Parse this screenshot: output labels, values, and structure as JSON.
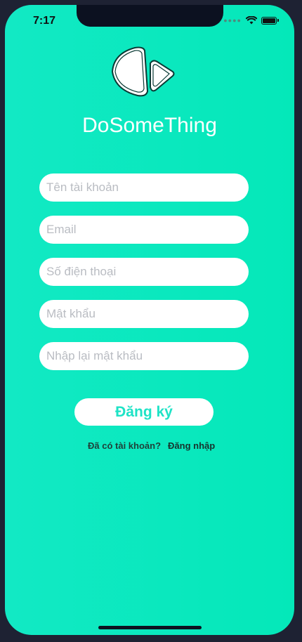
{
  "status_bar": {
    "time": "7:17",
    "signal_icon": "signal-dots-icon",
    "wifi_icon": "wifi-icon",
    "battery_icon": "battery-icon"
  },
  "brand": {
    "logo_icon": "play-triangles-logo",
    "app_name": "DoSomeThing"
  },
  "form": {
    "username_placeholder": "Tên tài khoản",
    "email_placeholder": "Email",
    "phone_placeholder": "Số điện thoại",
    "password_placeholder": "Mật khẩu",
    "confirm_password_placeholder": "Nhập lại mật khẩu",
    "register_label": "Đăng ký"
  },
  "footer": {
    "have_account_text": "Đã có tài khoản?",
    "login_link": "Đăng nhập"
  },
  "colors": {
    "background": "#0FE9C2",
    "accent_text": "#1EE3C6",
    "field_bg": "#FFFFFF"
  }
}
